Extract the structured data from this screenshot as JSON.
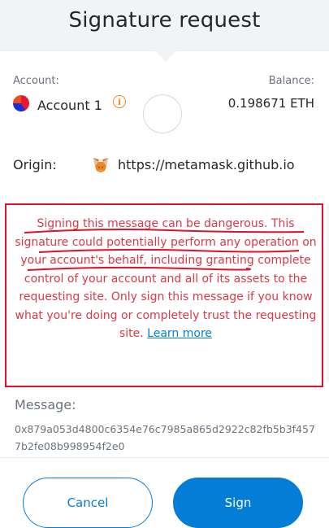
{
  "header": {
    "title": "Signature request"
  },
  "account": {
    "label": "Account:",
    "name": "Account 1",
    "info_icon": "info-icon",
    "balance_label": "Balance:",
    "balance": "0.198671 ETH"
  },
  "origin": {
    "label": "Origin:",
    "url": "https://metamask.github.io",
    "icon": "metamask-fox-icon"
  },
  "warning": {
    "text": "Signing this message can be dangerous. This signature could potentially perform any operation on your account's behalf, including granting complete control of your account and all of its assets to the requesting site. Only sign this message if you know what you're doing or completely trust the requesting site.",
    "link": "Learn more"
  },
  "message": {
    "label": "Message:",
    "value": "0x879a053d4800c6354e76c7985a865d2922c82fb5b3f4577b2fe08b998954f2e0"
  },
  "buttons": {
    "cancel": "Cancel",
    "sign": "Sign"
  },
  "colors": {
    "accent": "#037dd6",
    "warning_red": "#d73a49",
    "highlight_border": "#e0112b"
  }
}
